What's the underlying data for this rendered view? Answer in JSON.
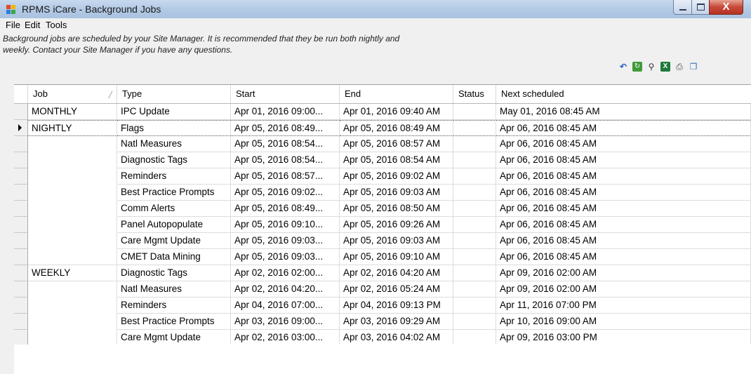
{
  "window": {
    "title": "RPMS iCare - Background Jobs",
    "close_glyph": "X"
  },
  "menu": {
    "items": [
      "File",
      "Edit",
      "Tools"
    ]
  },
  "info": {
    "line1": "Background jobs are scheduled by your Site Manager.  It is recommended that they be run both nightly and",
    "line2": "weekly.  Contact your Site Manager if you have any questions."
  },
  "toolbar_icons": [
    "undo-icon",
    "refresh-icon",
    "find-icon",
    "excel-export-icon",
    "print-icon",
    "copy-icon"
  ],
  "grid": {
    "columns": [
      "Job",
      "Type",
      "Start",
      "End",
      "Status",
      "Next scheduled"
    ],
    "sorted_column": "Job",
    "selected_row_index": 1,
    "rows": [
      {
        "job": "MONTHLY",
        "type": "IPC Update",
        "start": "Apr 01, 2016 09:00...",
        "end": "Apr 01, 2016 09:40 AM",
        "status": "",
        "next": "May 01, 2016 08:45 AM"
      },
      {
        "job": "NIGHTLY",
        "type": "Flags",
        "start": "Apr 05, 2016 08:49...",
        "end": "Apr 05, 2016 08:49 AM",
        "status": "",
        "next": "Apr 06, 2016 08:45 AM"
      },
      {
        "job": "",
        "type": "Natl Measures",
        "start": "Apr 05, 2016 08:54...",
        "end": "Apr 05, 2016 08:57 AM",
        "status": "",
        "next": "Apr 06, 2016 08:45 AM"
      },
      {
        "job": "",
        "type": "Diagnostic Tags",
        "start": "Apr 05, 2016 08:54...",
        "end": "Apr 05, 2016 08:54 AM",
        "status": "",
        "next": "Apr 06, 2016 08:45 AM"
      },
      {
        "job": "",
        "type": "Reminders",
        "start": "Apr 05, 2016 08:57...",
        "end": "Apr 05, 2016 09:02 AM",
        "status": "",
        "next": "Apr 06, 2016 08:45 AM"
      },
      {
        "job": "",
        "type": "Best Practice Prompts",
        "start": "Apr 05, 2016 09:02...",
        "end": "Apr 05, 2016 09:03 AM",
        "status": "",
        "next": "Apr 06, 2016 08:45 AM"
      },
      {
        "job": "",
        "type": "Comm Alerts",
        "start": "Apr 05, 2016 08:49...",
        "end": "Apr 05, 2016 08:50 AM",
        "status": "",
        "next": "Apr 06, 2016 08:45 AM"
      },
      {
        "job": "",
        "type": "Panel Autopopulate",
        "start": "Apr 05, 2016 09:10...",
        "end": "Apr 05, 2016 09:26 AM",
        "status": "",
        "next": "Apr 06, 2016 08:45 AM"
      },
      {
        "job": "",
        "type": "Care Mgmt Update",
        "start": "Apr 05, 2016 09:03...",
        "end": "Apr 05, 2016 09:03 AM",
        "status": "",
        "next": "Apr 06, 2016 08:45 AM"
      },
      {
        "job": "",
        "type": "CMET Data Mining",
        "start": "Apr 05, 2016 09:03...",
        "end": "Apr 05, 2016 09:10 AM",
        "status": "",
        "next": "Apr 06, 2016 08:45 AM"
      },
      {
        "job": "WEEKLY",
        "type": "Diagnostic Tags",
        "start": "Apr 02, 2016 02:00...",
        "end": "Apr 02, 2016 04:20 AM",
        "status": "",
        "next": "Apr 09, 2016 02:00 AM"
      },
      {
        "job": "",
        "type": "Natl Measures",
        "start": "Apr 02, 2016 04:20...",
        "end": "Apr 02, 2016 05:24 AM",
        "status": "",
        "next": "Apr 09, 2016 02:00 AM"
      },
      {
        "job": "",
        "type": "Reminders",
        "start": "Apr 04, 2016 07:00...",
        "end": "Apr 04, 2016 09:13 PM",
        "status": "",
        "next": "Apr 11, 2016 07:00 PM"
      },
      {
        "job": "",
        "type": "Best Practice Prompts",
        "start": "Apr 03, 2016 09:00...",
        "end": "Apr 03, 2016 09:29 AM",
        "status": "",
        "next": "Apr 10, 2016 09:00 AM"
      },
      {
        "job": "",
        "type": "Care Mgmt Update",
        "start": "Apr 02, 2016 03:00...",
        "end": "Apr 03, 2016 04:02 AM",
        "status": "",
        "next": "Apr 09, 2016 03:00 PM"
      }
    ]
  }
}
